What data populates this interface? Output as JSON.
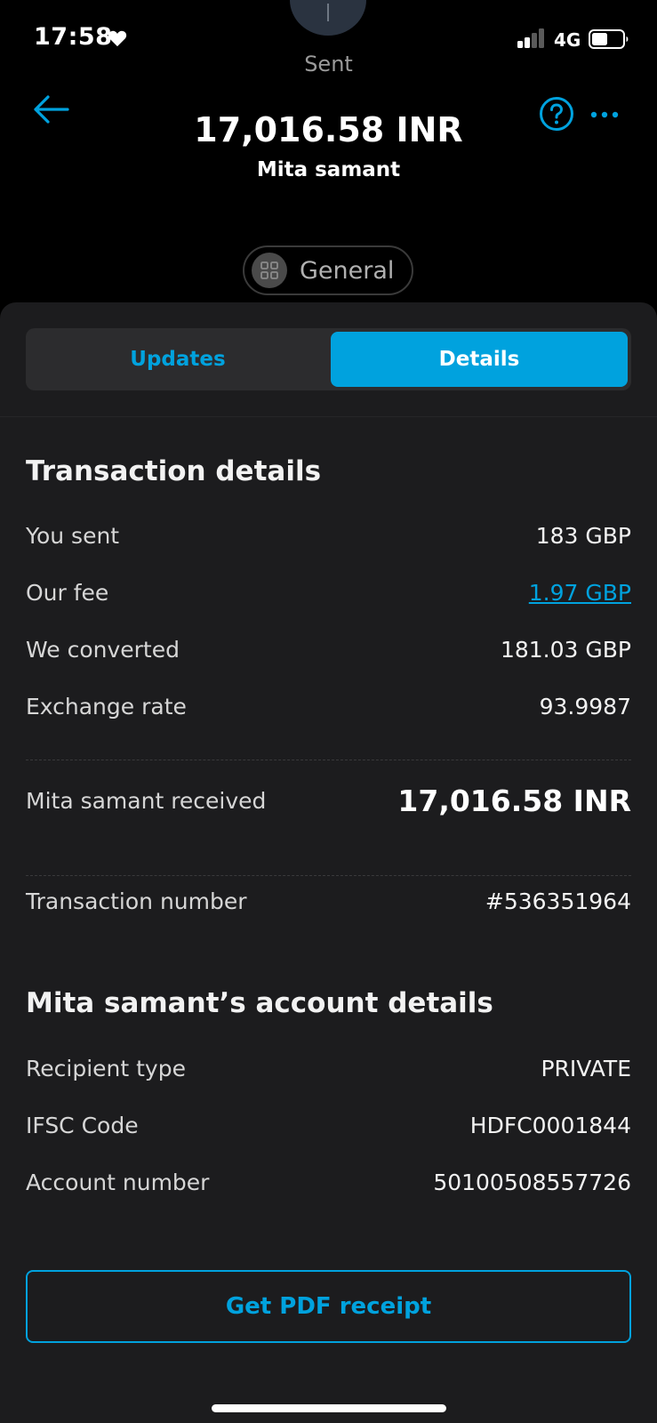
{
  "status_bar": {
    "time": "17:58",
    "network": "4G"
  },
  "header": {
    "status": "Sent",
    "amount": "17,016.58 INR",
    "recipient": "Mita samant",
    "category": "General"
  },
  "tabs": [
    {
      "label": "Updates",
      "active": false
    },
    {
      "label": "Details",
      "active": true
    }
  ],
  "transaction": {
    "title": "Transaction details",
    "rows": [
      {
        "label": "You sent",
        "value": "183 GBP"
      },
      {
        "label": "Our fee",
        "value": "1.97 GBP"
      },
      {
        "label": "We converted",
        "value": "181.03 GBP"
      },
      {
        "label": "Exchange rate",
        "value": "93.9987"
      }
    ],
    "received_label": "Mita samant received",
    "received_value": "17,016.58 INR",
    "number_label": "Transaction number",
    "number_value": "#536351964"
  },
  "account": {
    "title": "Mita samant’s account details",
    "rows": [
      {
        "label": "Recipient type",
        "value": "PRIVATE"
      },
      {
        "label": "IFSC Code",
        "value": "HDFC0001844"
      },
      {
        "label": "Account number",
        "value": "50100508557726"
      }
    ]
  },
  "actions": {
    "pdf_receipt": "Get PDF receipt"
  },
  "colors": {
    "accent": "#00a2de",
    "background": "#000000",
    "sheet": "#1c1c1e"
  }
}
